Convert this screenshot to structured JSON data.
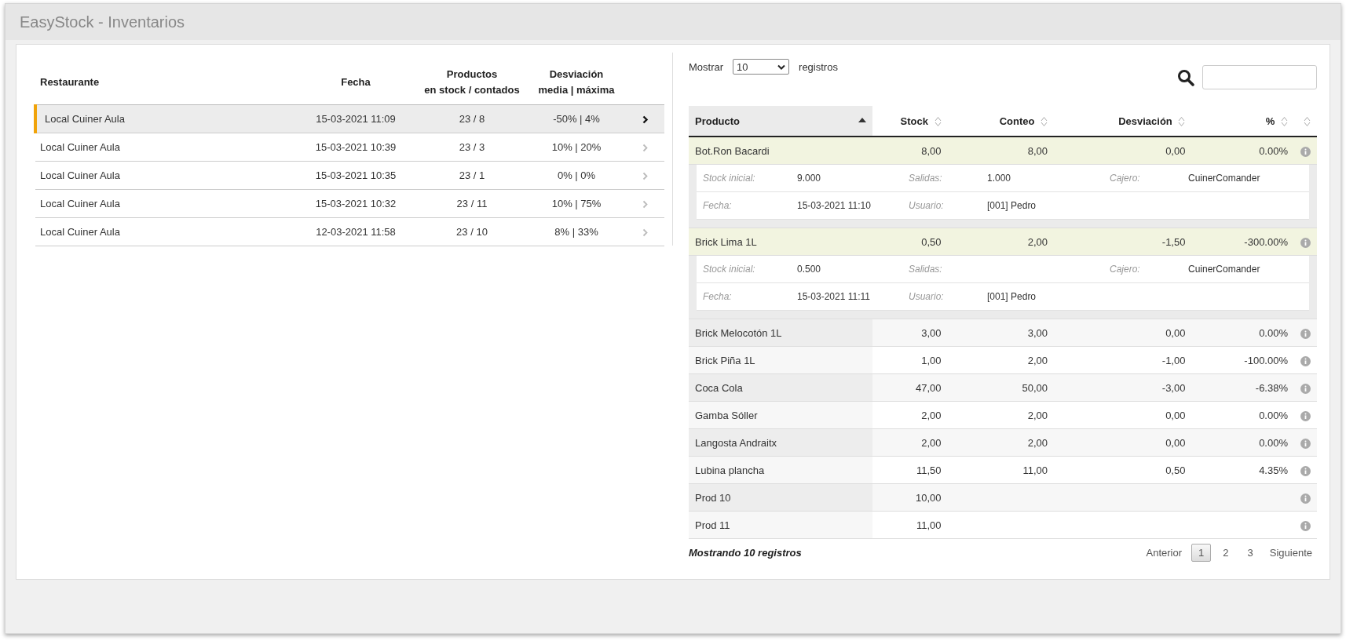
{
  "window": {
    "title": "EasyStock - Inventarios"
  },
  "inventories": {
    "columns": [
      {
        "label": "Restaurante"
      },
      {
        "label": "Fecha"
      },
      {
        "label": "Productos",
        "sublabel": "en stock / contados"
      },
      {
        "label": "Desviación",
        "sublabel": "media | máxima"
      }
    ],
    "rows": [
      {
        "restaurant": "Local Cuiner Aula",
        "date": "15-03-2021 11:09",
        "products": "23 / 8",
        "deviation": "-50% | 4%",
        "selected": true
      },
      {
        "restaurant": "Local Cuiner Aula",
        "date": "15-03-2021 10:39",
        "products": "23 / 3",
        "deviation": "10% | 20%",
        "selected": false
      },
      {
        "restaurant": "Local Cuiner Aula",
        "date": "15-03-2021 10:35",
        "products": "23 / 1",
        "deviation": "0% | 0%",
        "selected": false
      },
      {
        "restaurant": "Local Cuiner Aula",
        "date": "15-03-2021 10:32",
        "products": "23 / 11",
        "deviation": "10% | 75%",
        "selected": false
      },
      {
        "restaurant": "Local Cuiner Aula",
        "date": "12-03-2021 11:58",
        "products": "23 / 10",
        "deviation": "8% | 33%",
        "selected": false
      }
    ]
  },
  "products": {
    "length_before": "Mostrar",
    "length_value": "10",
    "length_after": "registros",
    "columns": [
      {
        "label": "Producto",
        "sorted": true
      },
      {
        "label": "Stock",
        "sorted": false
      },
      {
        "label": "Conteo",
        "sorted": false
      },
      {
        "label": "Desviación",
        "sorted": false
      },
      {
        "label": "%",
        "sorted": false
      }
    ],
    "actions_column": {
      "sorted": false
    },
    "rows": [
      {
        "product": "Bot.Ron Bacardi",
        "stock": "8,00",
        "count": "8,00",
        "deviation": "0,00",
        "percent": "0.00%",
        "expanded": true,
        "details": [
          [
            {
              "label": "Stock inicial:",
              "value": "9.000"
            },
            {
              "label": "Salidas:",
              "value": "1.000"
            },
            {
              "label": "Cajero:",
              "value": "CuinerComander"
            }
          ],
          [
            {
              "label": "Fecha:",
              "value": "15-03-2021 11:10"
            },
            {
              "label": "Usuario:",
              "value": "[001] Pedro"
            }
          ]
        ]
      },
      {
        "product": "Brick Lima 1L",
        "stock": "0,50",
        "count": "2,00",
        "deviation": "-1,50",
        "percent": "-300.00%",
        "expanded": true,
        "details": [
          [
            {
              "label": "Stock inicial:",
              "value": "0.500"
            },
            {
              "label": "Salidas:"
            },
            {
              "label": "Cajero:",
              "value": "CuinerComander"
            }
          ],
          [
            {
              "label": "Fecha:",
              "value": "15-03-2021 11:11"
            },
            {
              "label": "Usuario:",
              "value": "[001] Pedro"
            }
          ]
        ]
      },
      {
        "product": "Brick Melocotón 1L",
        "stock": "3,00",
        "count": "3,00",
        "deviation": "0,00",
        "percent": "0.00%",
        "expanded": false
      },
      {
        "product": "Brick Piña 1L",
        "stock": "1,00",
        "count": "2,00",
        "deviation": "-1,00",
        "percent": "-100.00%",
        "expanded": false
      },
      {
        "product": "Coca Cola",
        "stock": "47,00",
        "count": "50,00",
        "deviation": "-3,00",
        "percent": "-6.38%",
        "expanded": false
      },
      {
        "product": "Gamba Sóller",
        "stock": "2,00",
        "count": "2,00",
        "deviation": "0,00",
        "percent": "0.00%",
        "expanded": false
      },
      {
        "product": "Langosta Andraitx",
        "stock": "2,00",
        "count": "2,00",
        "deviation": "0,00",
        "percent": "0.00%",
        "expanded": false
      },
      {
        "product": "Lubina plancha",
        "stock": "11,50",
        "count": "11,00",
        "deviation": "0,50",
        "percent": "4.35%",
        "expanded": false
      },
      {
        "product": "Prod 10",
        "stock": "10,00",
        "expanded": false
      },
      {
        "product": "Prod 11",
        "stock": "11,00",
        "expanded": false
      }
    ],
    "info": "Mostrando 10 registros",
    "pagination": {
      "previous": "Anterior",
      "pages": [
        {
          "label": "1",
          "selected": true
        },
        {
          "label": "2",
          "selected": false
        },
        {
          "label": "3",
          "selected": false
        }
      ],
      "next": "Siguiente"
    }
  }
}
